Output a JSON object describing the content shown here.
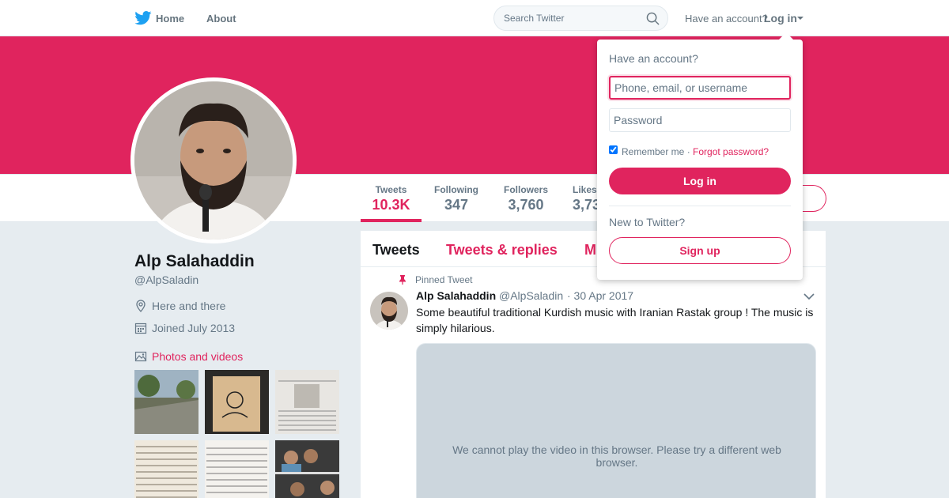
{
  "nav": {
    "home_label": "Home",
    "about_label": "About",
    "search_placeholder": "Search Twitter",
    "have_account_text": "Have an account?",
    "login_label": "Log in"
  },
  "colors": {
    "accent": "#e0245e",
    "banner": "#e0245e",
    "background": "#e6ecf0"
  },
  "profile": {
    "name": "Alp Salahaddin",
    "handle": "@AlpSaladin",
    "location": "Here and there",
    "joined": "Joined July 2013",
    "photos_label": "Photos and videos"
  },
  "stats": [
    {
      "label": "Tweets",
      "value": "10.3K"
    },
    {
      "label": "Following",
      "value": "347"
    },
    {
      "label": "Followers",
      "value": "3,760"
    },
    {
      "label": "Likes",
      "value": "3,73"
    }
  ],
  "timeline": {
    "tabs": [
      "Tweets",
      "Tweets & replies",
      "M"
    ],
    "pinned_label": "Pinned Tweet",
    "tweet": {
      "name": "Alp Salahaddin",
      "handle": "@AlpSaladin",
      "date": "· 30 Apr 2017",
      "text": "Some beautiful traditional Kurdish music with Iranian Rastak group ! The music is simply hilarious.",
      "video_message": "We cannot play the video in this browser. Please try a different web browser."
    }
  },
  "login_dropdown": {
    "title": "Have an account?",
    "username_placeholder": "Phone, email, or username",
    "password_placeholder": "Password",
    "remember_text": "Remember me ·",
    "forgot_text": "Forgot password?",
    "login_button": "Log in",
    "new_text": "New to Twitter?",
    "signup_button": "Sign up"
  }
}
